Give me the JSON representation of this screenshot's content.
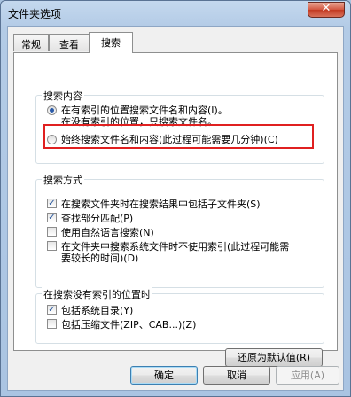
{
  "window": {
    "title": "文件夹选项",
    "close_glyph": "✕"
  },
  "tabs": [
    {
      "label": "常规"
    },
    {
      "label": "查看"
    },
    {
      "label": "搜索"
    }
  ],
  "search_content": {
    "label": "搜索内容",
    "option1_line1": "在有索引的位置搜索文件名和内容(I)。",
    "option1_line2": "在没有索引的位置，只搜索文件名。",
    "option2": "始终搜索文件名和内容(此过程可能需要几分钟)(C)"
  },
  "search_mode": {
    "label": "搜索方式",
    "items": [
      {
        "text": "在搜索文件夹时在搜索结果中包括子文件夹(S)",
        "checked": true
      },
      {
        "text": "查找部分匹配(P)",
        "checked": true
      },
      {
        "text": "使用自然语言搜索(N)",
        "checked": false
      },
      {
        "text": "在文件夹中搜索系统文件时不使用索引(此过程可能需",
        "text2": "要较长的时间)(D)",
        "checked": false
      }
    ]
  },
  "non_indexed": {
    "label": "在搜索没有索引的位置时",
    "items": [
      {
        "text": "包括系统目录(Y)",
        "checked": true
      },
      {
        "text": "包括压缩文件(ZIP、CAB...)(Z)",
        "checked": false
      }
    ]
  },
  "buttons": {
    "restore": "还原为默认值(R)",
    "ok": "确定",
    "cancel": "取消",
    "apply": "应用(A)"
  }
}
